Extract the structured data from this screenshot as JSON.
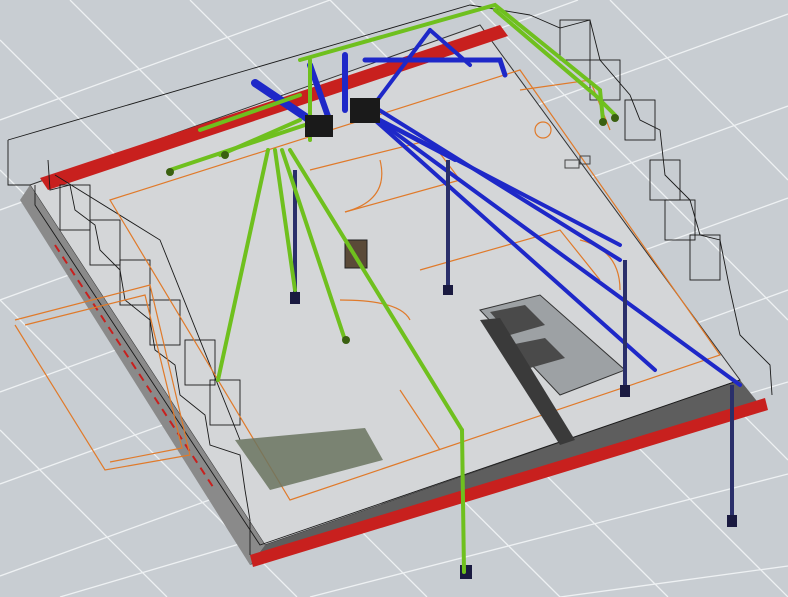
{
  "viewport": {
    "view": "3d-isometric",
    "colors": {
      "background": "#c8cdd2",
      "grid_line": "#e8ecef",
      "floor": "#d3d5d7",
      "wall_edge": "#1a1a1a",
      "red_band": "#c8201e",
      "orange_lines": "#e07a2a",
      "blue_pipes": "#1e28c8",
      "green_pipes": "#6fc01e",
      "dark_pad": "#6a7460"
    }
  }
}
